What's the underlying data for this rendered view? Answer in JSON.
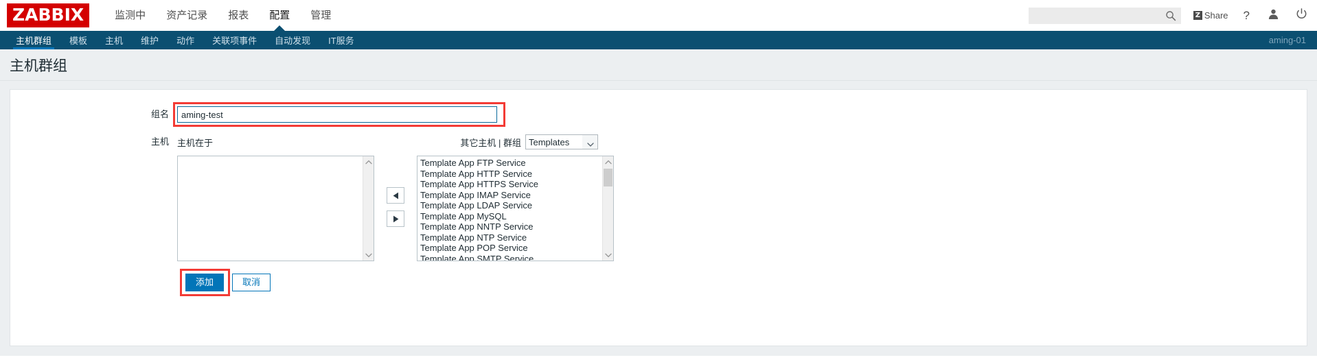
{
  "header": {
    "logo": "ZABBIX",
    "main_nav": [
      {
        "label": "监测中",
        "selected": false
      },
      {
        "label": "资产记录",
        "selected": false
      },
      {
        "label": "报表",
        "selected": false
      },
      {
        "label": "配置",
        "selected": true
      },
      {
        "label": "管理",
        "selected": false
      }
    ],
    "search": {
      "value": "",
      "placeholder": ""
    },
    "share_label": "Share",
    "share_badge": "Z",
    "help_label": "?"
  },
  "subnav": {
    "items": [
      {
        "label": "主机群组",
        "selected": true
      },
      {
        "label": "模板",
        "selected": false
      },
      {
        "label": "主机",
        "selected": false
      },
      {
        "label": "维护",
        "selected": false
      },
      {
        "label": "动作",
        "selected": false
      },
      {
        "label": "关联项事件",
        "selected": false
      },
      {
        "label": "自动发现",
        "selected": false
      },
      {
        "label": "IT服务",
        "selected": false
      }
    ],
    "user": "aming-01"
  },
  "page": {
    "title": "主机群组"
  },
  "form": {
    "group_name": {
      "label": "组名",
      "value": "aming-test",
      "placeholder": ""
    },
    "hosts": {
      "label": "主机",
      "left_caption": "主机在于",
      "right_caption": "其它主机 | 群组",
      "group_select": {
        "value": "Templates",
        "options": [
          "Templates"
        ]
      },
      "left_items": [],
      "right_items": [
        "Template App FTP Service",
        "Template App HTTP Service",
        "Template App HTTPS Service",
        "Template App IMAP Service",
        "Template App LDAP Service",
        "Template App MySQL",
        "Template App NNTP Service",
        "Template App NTP Service",
        "Template App POP Service",
        "Template App SMTP Service"
      ],
      "move_left_label": "◀",
      "move_right_label": "▶"
    },
    "buttons": {
      "submit": "添加",
      "cancel": "取消"
    }
  },
  "colors": {
    "brand_red": "#d40000",
    "nav_blue": "#0b4f71",
    "accent_blue": "#0275b8",
    "highlight_red": "#f33b35"
  }
}
